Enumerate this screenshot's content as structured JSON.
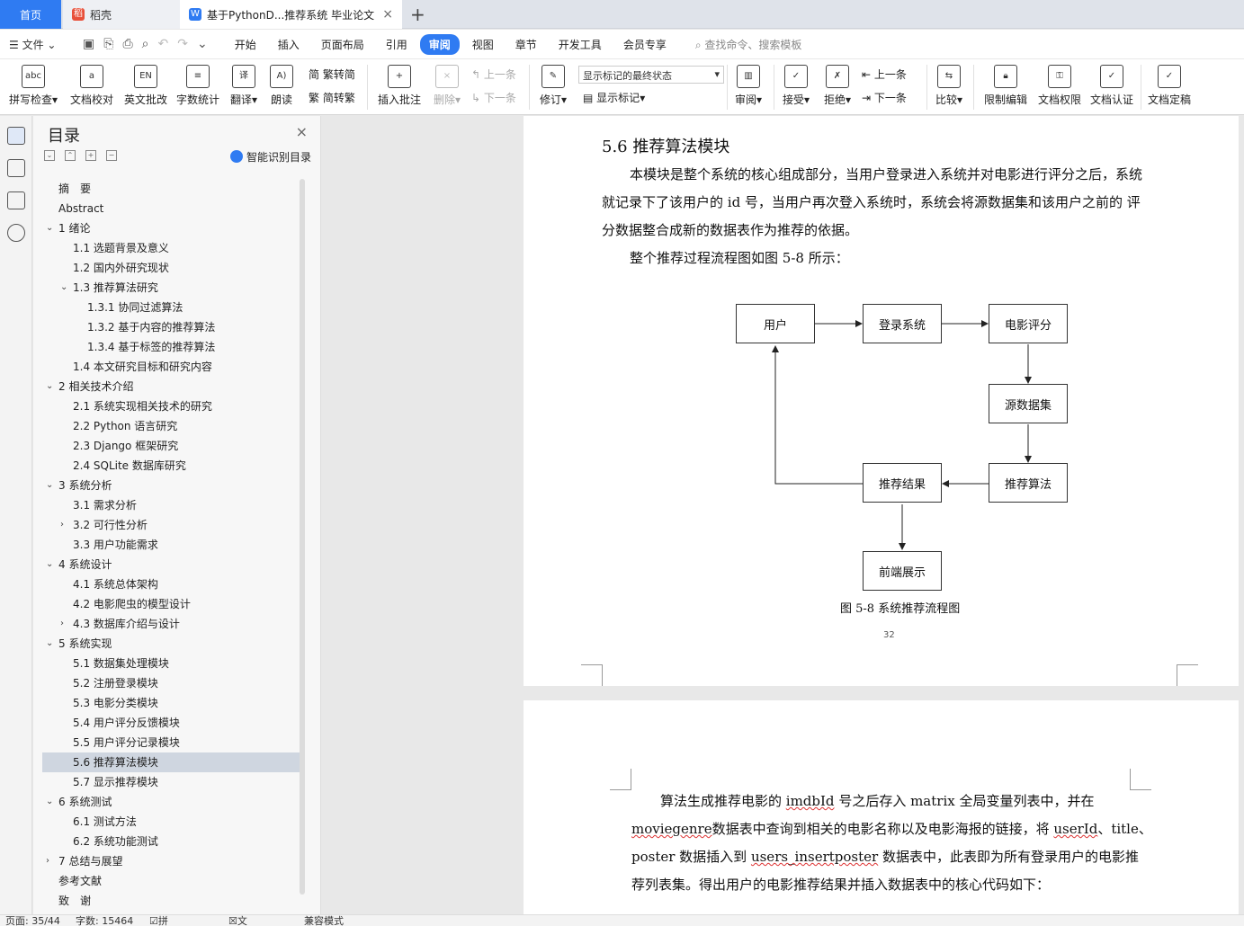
{
  "tabs": {
    "home": "首页",
    "daoke": "稻壳",
    "document": "基于PythonD...推荐系统 毕业论文",
    "add": "+",
    "close": "×"
  },
  "menu": {
    "file": "文件",
    "items": [
      "开始",
      "插入",
      "页面布局",
      "引用",
      "审阅",
      "视图",
      "章节",
      "开发工具",
      "会员专享"
    ],
    "active": "审阅",
    "search": "查找命令、搜索模板"
  },
  "ribbon": {
    "spell": "拼写检查",
    "doc_check": "文档校对",
    "en_review": "英文批改",
    "word_count": "字数统计",
    "translate": "翻译",
    "read_aloud": "朗读",
    "trad_to_simp": "繁转简",
    "simp_to_trad": "简转繁",
    "insert_comment": "插入批注",
    "delete": "删除",
    "prev": "上一条",
    "next": "下一条",
    "revise": "修订",
    "markup_state": "显示标记的最终状态",
    "show_markup": "显示标记",
    "review": "审阅",
    "accept": "接受",
    "reject": "拒绝",
    "prev2": "上一条",
    "next2": "下一条",
    "compare": "比较",
    "restrict_edit": "限制编辑",
    "doc_permission": "文档权限",
    "doc_cert": "文档认证",
    "doc_finalize": "文档定稿"
  },
  "nav": {
    "title": "目录",
    "smart": "智能识别目录",
    "items": [
      {
        "text": "摘　要",
        "level": 0,
        "arrow": ""
      },
      {
        "text": "Abstract",
        "level": 0,
        "arrow": ""
      },
      {
        "text": "1 绪论",
        "level": 0,
        "arrow": "v"
      },
      {
        "text": "1.1 选题背景及意义",
        "level": 1,
        "arrow": ""
      },
      {
        "text": "1.2 国内外研究现状",
        "level": 1,
        "arrow": ""
      },
      {
        "text": "1.3 推荐算法研究",
        "level": 1,
        "arrow": "v"
      },
      {
        "text": "1.3.1 协同过滤算法",
        "level": 2,
        "arrow": ""
      },
      {
        "text": "1.3.2 基于内容的推荐算法",
        "level": 2,
        "arrow": ""
      },
      {
        "text": "1.3.4 基于标签的推荐算法",
        "level": 2,
        "arrow": ""
      },
      {
        "text": "1.4 本文研究目标和研究内容",
        "level": 1,
        "arrow": ""
      },
      {
        "text": "2 相关技术介绍",
        "level": 0,
        "arrow": "v"
      },
      {
        "text": "2.1 系统实现相关技术的研究",
        "level": 1,
        "arrow": ""
      },
      {
        "text": "2.2 Python 语言研究",
        "level": 1,
        "arrow": ""
      },
      {
        "text": "2.3 Django 框架研究",
        "level": 1,
        "arrow": ""
      },
      {
        "text": "2.4 SQLite 数据库研究",
        "level": 1,
        "arrow": ""
      },
      {
        "text": "3 系统分析",
        "level": 0,
        "arrow": "v"
      },
      {
        "text": "3.1 需求分析",
        "level": 1,
        "arrow": ""
      },
      {
        "text": "3.2 可行性分析",
        "level": 1,
        "arrow": ">"
      },
      {
        "text": "3.3 用户功能需求",
        "level": 1,
        "arrow": ""
      },
      {
        "text": "4 系统设计",
        "level": 0,
        "arrow": "v"
      },
      {
        "text": "4.1 系统总体架构",
        "level": 1,
        "arrow": ""
      },
      {
        "text": "4.2 电影爬虫的模型设计",
        "level": 1,
        "arrow": ""
      },
      {
        "text": "4.3 数据库介绍与设计",
        "level": 1,
        "arrow": ">"
      },
      {
        "text": "5 系统实现",
        "level": 0,
        "arrow": "v"
      },
      {
        "text": "5.1 数据集处理模块",
        "level": 1,
        "arrow": ""
      },
      {
        "text": "5.2 注册登录模块",
        "level": 1,
        "arrow": ""
      },
      {
        "text": "5.3 电影分类模块",
        "level": 1,
        "arrow": ""
      },
      {
        "text": "5.4 用户评分反馈模块",
        "level": 1,
        "arrow": ""
      },
      {
        "text": "5.5 用户评分记录模块",
        "level": 1,
        "arrow": ""
      },
      {
        "text": "5.6 推荐算法模块",
        "level": 1,
        "arrow": "",
        "selected": true
      },
      {
        "text": "5.7 显示推荐模块",
        "level": 1,
        "arrow": ""
      },
      {
        "text": "6 系统测试",
        "level": 0,
        "arrow": "v"
      },
      {
        "text": "6.1 测试方法",
        "level": 1,
        "arrow": ""
      },
      {
        "text": "6.2 系统功能测试",
        "level": 1,
        "arrow": ""
      },
      {
        "text": "7 总结与展望",
        "level": 0,
        "arrow": ">"
      },
      {
        "text": "参考文献",
        "level": 0,
        "arrow": ""
      },
      {
        "text": "致　谢",
        "level": 0,
        "arrow": ""
      }
    ]
  },
  "page1": {
    "heading": "5.6 推荐算法模块",
    "para1_l1": "本模块是整个系统的核心组成部分，当用户登录进入系统并对电影进行评分之后，系统",
    "para1_l2": "就记录下了该用户的 id 号，当用户再次登入系统时，系统会将源数据集和该用户之前的 评",
    "para1_l3": "分数据整合成新的数据表作为推荐的依据。",
    "para2": "整个推荐过程流程图如图 5-8 所示：",
    "flow": {
      "user": "用户",
      "login": "登录系统",
      "rating": "电影评分",
      "source": "源数据集",
      "algo": "推荐算法",
      "result": "推荐结果",
      "front": "前端展示"
    },
    "caption": "图 5-8 系统推荐流程图",
    "page_number": "32"
  },
  "page2": {
    "l1_a": "算法生成推荐电影的 ",
    "l1_b": "imdbId",
    "l1_c": " 号之后存入 matrix 全局变量列表中，并在",
    "l2_a": "moviegenre",
    "l2_b": "数据表中查询到相关的电影名称以及电影海报的链接，将 ",
    "l2_c": "userId",
    "l2_d": "、title、",
    "l3_a": "poster 数据插入到 ",
    "l3_b": "users_insertposter",
    "l3_c": " 数据表中，此表即为所有登录用户的电影推",
    "l4": "荐列表集。得出用户的电影推荐结果并插入数据表中的核心代码如下："
  },
  "status": {
    "page": "页面: 35/44",
    "words": "字数: 15464",
    "spell": "拼写检查",
    "proof": "文档校对",
    "compat": "兼容模式"
  },
  "colors": {
    "accent": "#2f7bf2",
    "selected_toc": "#cfd6e0"
  }
}
